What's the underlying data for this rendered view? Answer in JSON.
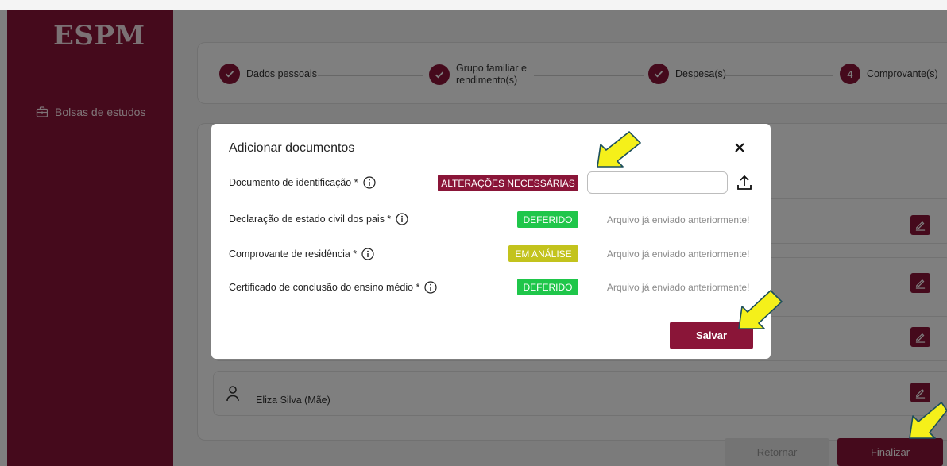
{
  "app": {
    "logo": "ESPM"
  },
  "sidebar": {
    "items": [
      {
        "label": "Bolsas de estudos",
        "icon": "briefcase-icon"
      }
    ]
  },
  "stepper": {
    "steps": [
      {
        "label": "Dados pessoais",
        "state": "done"
      },
      {
        "label_line1": "Grupo familiar e",
        "label_line2": "rendimento(s)",
        "state": "done"
      },
      {
        "label": "Despesa(s)",
        "state": "done"
      },
      {
        "number": "4",
        "label": "Comprovante(s)",
        "state": "current"
      }
    ]
  },
  "members": [
    {
      "name": "Eliza Silva (Mãe)",
      "icon": "person-icon"
    }
  ],
  "footer": {
    "back_label": "Retornar",
    "finish_label": "Finalizar"
  },
  "modal": {
    "title": "Adicionar documentos",
    "documents": [
      {
        "label": "Documento de identificação *",
        "status": "ALTERAÇÕES NECESSÁRIAS",
        "status_color": "#8a1538",
        "file_value": ""
      },
      {
        "label": "Declaração de estado civil dos pais *",
        "status": "DEFERIDO",
        "status_color": "#1fc64a",
        "note": "Arquivo já enviado anteriormente!"
      },
      {
        "label": "Comprovante de residência *",
        "status": "EM ANÁLISE",
        "status_color": "#c3c31d",
        "note": "Arquivo já enviado anteriormente!"
      },
      {
        "label": "Certificado de conclusão do ensino médio *",
        "status": "DEFERIDO",
        "status_color": "#1fc64a",
        "note": "Arquivo já enviado anteriormente!"
      }
    ],
    "save_label": "Salvar"
  },
  "colors": {
    "brand": "#8a1538",
    "approved": "#1fc64a",
    "review": "#c3c31d",
    "highlight_arrow": "#f5f01a"
  }
}
